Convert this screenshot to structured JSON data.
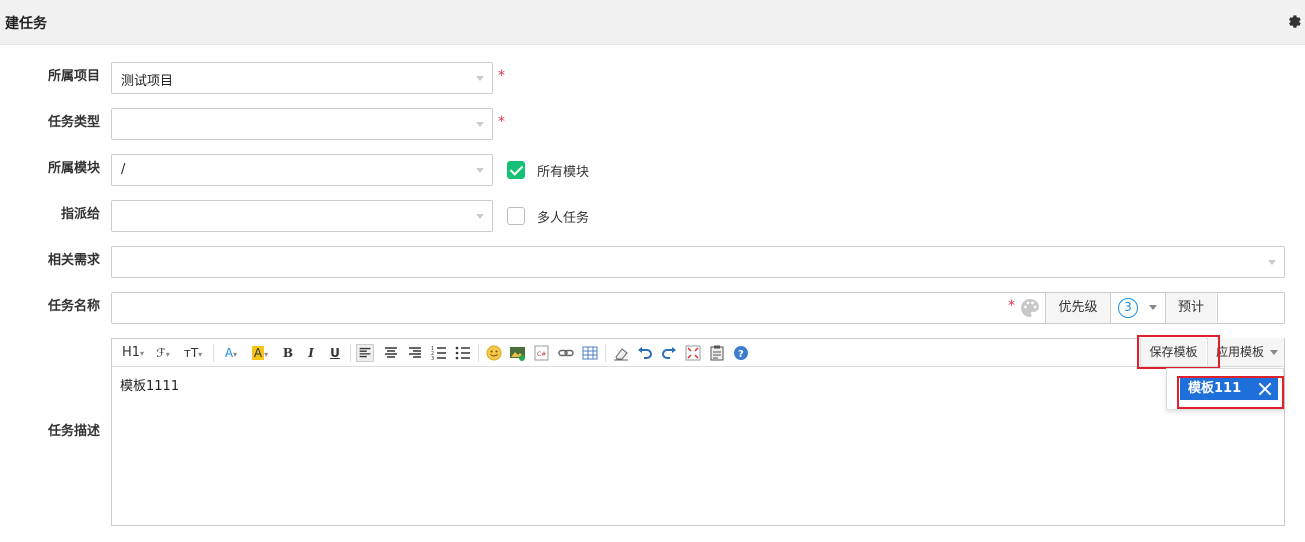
{
  "header": {
    "title": "建任务",
    "settings_icon": "gear-icon"
  },
  "form": {
    "project": {
      "label": "所属项目",
      "value": "测试项目"
    },
    "task_type": {
      "label": "任务类型",
      "value": ""
    },
    "module": {
      "label": "所属模块",
      "value": "/",
      "all_modules_label": "所有模块",
      "all_modules_checked": true
    },
    "assignee": {
      "label": "指派给",
      "value": "",
      "multi_label": "多人任务",
      "multi_checked": false
    },
    "story": {
      "label": "相关需求",
      "value": ""
    },
    "name": {
      "label": "任务名称",
      "value": "",
      "priority_label": "优先级",
      "priority_value": "3",
      "estimate_label": "预计",
      "estimate_value": ""
    },
    "desc": {
      "label": "任务描述",
      "content": "模板1111"
    },
    "required_mark": "*"
  },
  "editor": {
    "toolbar": {
      "heading": "H1",
      "font_family": "ℱ",
      "font_size": "тT",
      "font_color": "A",
      "bg_color": "A",
      "bold": "B",
      "italic": "I",
      "underline": "U"
    },
    "save_template": "保存模板",
    "apply_template": "应用模板",
    "templates": [
      "模板111"
    ]
  },
  "colors": {
    "accent": "#1e6fd9",
    "required": "#e0344c",
    "checked": "#16c177",
    "highlight": "#e0202c"
  }
}
